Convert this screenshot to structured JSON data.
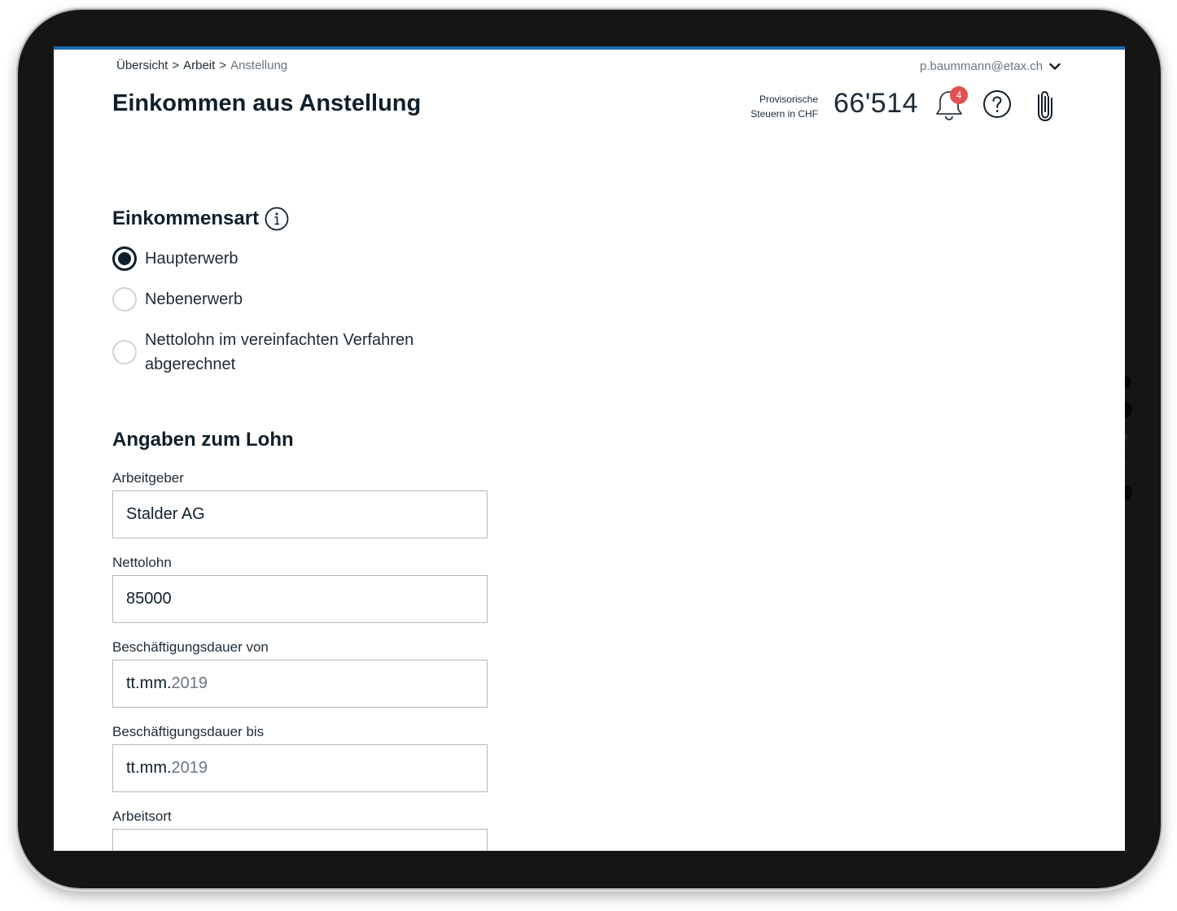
{
  "breadcrumb": {
    "item1": "Übersicht",
    "sep": ">",
    "item2": "Arbeit",
    "current": "Anstellung"
  },
  "header": {
    "title": "Einkommen aus Anstellung",
    "user_email": "p.baummann@etax.ch",
    "tax_label_line1": "Provisorische",
    "tax_label_line2": "Steuern in CHF",
    "tax_value": "66'514",
    "notification_count": "4"
  },
  "income_type": {
    "title": "Einkommensart",
    "options": [
      {
        "label": "Haupterwerb",
        "checked": true
      },
      {
        "label": "Nebenerwerb",
        "checked": false
      },
      {
        "label_line1": "Nettolohn im vereinfachten Verfahren",
        "label_line2": "abgerechnet",
        "checked": false
      }
    ]
  },
  "salary": {
    "title": "Angaben zum Lohn",
    "employer_label": "Arbeitgeber",
    "employer_value": "Stalder AG",
    "net_label": "Nettolohn",
    "net_value": "85000",
    "from_label": "Beschäftigungsdauer von",
    "from_prefix": "tt.mm.",
    "from_year": "2019",
    "to_label": "Beschäftigungsdauer bis",
    "to_prefix": "tt.mm.",
    "to_year": "2019",
    "place_label": "Arbeitsort",
    "place_value": ""
  },
  "colors": {
    "accent": "#1f6bb0",
    "text": "#0f1f2b",
    "badge": "#e25050"
  }
}
